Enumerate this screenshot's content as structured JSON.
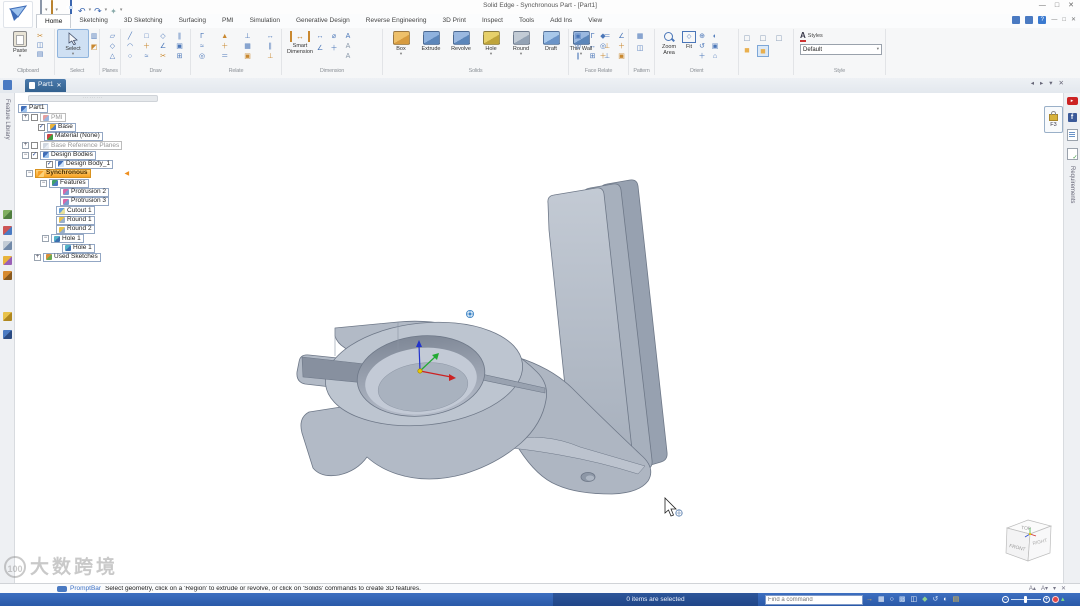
{
  "window": {
    "title": "Solid Edge - Synchronous Part - [Part1]"
  },
  "qat": {
    "icons": [
      "new",
      "open",
      "import",
      "save",
      "save-as",
      "window",
      "library",
      "undo",
      "redo",
      "share"
    ]
  },
  "menu": {
    "tabs": [
      "Home",
      "Sketching",
      "3D Sketching",
      "Surfacing",
      "PMI",
      "Simulation",
      "Generative Design",
      "Reverse Engineering",
      "3D Print",
      "Inspect",
      "Tools",
      "Add Ins",
      "View"
    ],
    "active": "Home"
  },
  "ribbon": {
    "clipboard": {
      "label": "Clipboard",
      "paste": "Paste"
    },
    "select": {
      "label": "Select",
      "button": "Select"
    },
    "planes": {
      "label": "Planes",
      "tools": [
        "plane",
        "coincident",
        "angled"
      ]
    },
    "draw": {
      "label": "Draw",
      "tools": [
        "line",
        "arc",
        "circle",
        "rect",
        "point",
        "curve",
        "polygon",
        "chamfer",
        "trim",
        "offset",
        "project",
        "grid"
      ]
    },
    "relate": {
      "label": "Relate",
      "tools": [
        "connect",
        "match",
        "concentric",
        "rigid",
        "point",
        "equal",
        "perpendicular",
        "pattern",
        "lock",
        "symmetric",
        "parallel",
        "ground"
      ]
    },
    "dimension": {
      "label": "Dimension",
      "smart": "Smart Dimension",
      "tools": [
        "distance",
        "angle",
        "diameter",
        "coordinate"
      ],
      "font_tools": [
        "font-up",
        "font-down",
        "font-small"
      ]
    },
    "solids": {
      "label": "Solids",
      "buttons": [
        "Box",
        "Extrude",
        "Revolve",
        "Hole",
        "Round",
        "Draft",
        "Thin Wall"
      ],
      "extra": [
        "web",
        "part-copy",
        "construct"
      ]
    },
    "face_relate": {
      "label": "Face Relate",
      "tools": [
        "project",
        "concentric",
        "parallel",
        "connect",
        "symmetric",
        "grid",
        "equal",
        "ground",
        "perpendicular",
        "chamfer",
        "point",
        "lock"
      ]
    },
    "pattern": {
      "label": "Pattern",
      "tools": [
        "rectangular",
        "mirror"
      ]
    },
    "orient": {
      "label": "Orient",
      "zoom_area": "Zoom Area",
      "fit": "Fit",
      "tools": [
        "zoom-in",
        "rotate",
        "pan",
        "look",
        "sketch-view",
        "home"
      ]
    },
    "view_styles": {
      "tools": [
        "wire-cube",
        "wire-cube",
        "wire-cube",
        "shaded-cube",
        "shaded-edges-cube"
      ],
      "active_index": 4
    },
    "style": {
      "label": "Style",
      "caption": "Styles",
      "value": "Default"
    }
  },
  "doc_tab": {
    "label": "Part1"
  },
  "rails": {
    "left": "Feature Library",
    "right": "Requirements"
  },
  "edgebar_icons": [
    "image",
    "layers",
    "sensors",
    "palette",
    "document",
    "key",
    "apps"
  ],
  "web_icons": [
    "youtube",
    "facebook",
    "form",
    "checklist"
  ],
  "lock_button": {
    "shortcut": "F3"
  },
  "pathfinder": {
    "items": [
      {
        "label": "Part1",
        "indent": 2,
        "icon": "part"
      },
      {
        "label": "PMI",
        "indent": 8,
        "exp": "plus",
        "chk": "off",
        "icon": "pmi",
        "gray": true
      },
      {
        "label": "Base",
        "indent": 22,
        "chk": "on",
        "icon": "base"
      },
      {
        "label": "Material (None)",
        "indent": 28,
        "icon": "material"
      },
      {
        "label": "Base Reference Planes",
        "indent": 8,
        "exp": "plus",
        "chk": "off",
        "icon": "planes",
        "gray": true
      },
      {
        "label": "Design Bodies",
        "indent": 8,
        "exp": "minus",
        "chk": "on",
        "icon": "bodies"
      },
      {
        "label": "Design Body_1",
        "indent": 30,
        "chk": "on",
        "icon": "body"
      },
      {
        "label": "Synchronous",
        "indent": 12,
        "exp": "minus",
        "icon": "sync",
        "orange": true
      },
      {
        "label": "Features",
        "indent": 26,
        "exp": "minus",
        "icon": "features"
      },
      {
        "label": "Protrusion 2",
        "indent": 44,
        "icon": "protrusion"
      },
      {
        "label": "Protrusion 3",
        "indent": 44,
        "icon": "protrusion"
      },
      {
        "label": "Cutout 1",
        "indent": 40,
        "icon": "cutout"
      },
      {
        "label": "Round 1",
        "indent": 40,
        "icon": "round"
      },
      {
        "label": "Round 2",
        "indent": 40,
        "icon": "round"
      },
      {
        "label": "Hole 1",
        "indent": 28,
        "exp": "minus",
        "icon": "hole"
      },
      {
        "label": "Hole 1",
        "indent": 46,
        "icon": "hole"
      },
      {
        "label": "Used Sketches",
        "indent": 20,
        "exp": "plus",
        "icon": "sketches"
      }
    ]
  },
  "viewport": {
    "viewcube": {
      "top": "TOP",
      "front": "FRONT",
      "right": "RIGHT"
    }
  },
  "prompt_bar": {
    "label": "PromptBar",
    "message": "Select geometry, click on a 'Region' to extrude or revolve, or click on 'Solids' commands to create 3D features."
  },
  "status_bar": {
    "selection": "0 items are selected",
    "find_placeholder": "Find a command",
    "icons": [
      "pan",
      "window",
      "zoom",
      "grid",
      "sheet",
      "render",
      "rotate",
      "shade",
      "layers"
    ]
  },
  "watermark": {
    "badge": "100",
    "text": "大数跨境"
  },
  "colors": {
    "accent": "#2f6bbf",
    "status_bar": "#2e5cae",
    "highlight": "#f7a928",
    "part": "#b6bec9",
    "tab": "#33618f"
  }
}
